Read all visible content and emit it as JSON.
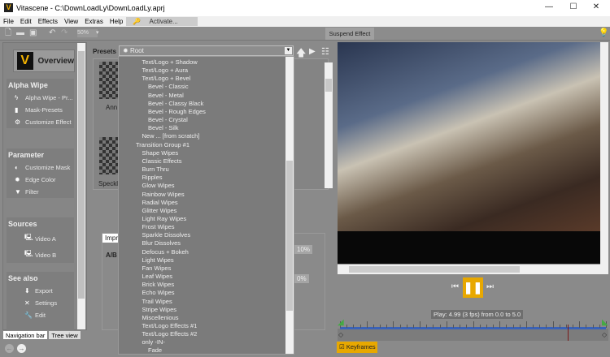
{
  "window": {
    "title": "Vitascene - C:\\DownLoadLy\\DownLoadLy.aprj",
    "minimize": "—",
    "maximize": "☐",
    "close": "✕"
  },
  "menu": [
    "File",
    "Edit",
    "Effects",
    "View",
    "Extras",
    "Help"
  ],
  "activate": "Activate...",
  "toolbar": {
    "zoom": "50%",
    "suspend": "Suspend Effect"
  },
  "overview": "Overview",
  "groups": [
    {
      "title": "Alpha Wipe",
      "items": [
        "Alpha Wipe - Pr...",
        "Mask-Presets",
        "Customize Effect"
      ]
    },
    {
      "title": "Parameter",
      "items": [
        "Customize Mask",
        "Edge Color",
        "Filter"
      ]
    },
    {
      "title": "Sources",
      "items": [
        "Video A",
        "Video B"
      ]
    },
    {
      "title": "See also",
      "items": [
        "Export",
        "Settings",
        "Edit"
      ]
    }
  ],
  "tabs": [
    "Navigation bar",
    "Tree view"
  ],
  "presets": {
    "label": "Presets",
    "root": "Root",
    "thumbs": [
      "Ann",
      "Speckl"
    ]
  },
  "dropdown": [
    {
      "t": "Text/Logo + Shadow",
      "l": 1
    },
    {
      "t": "Text/Logo + Aura",
      "l": 1
    },
    {
      "t": "Text/Logo + Bevel",
      "l": 1
    },
    {
      "t": "Bevel - Classic",
      "l": 2
    },
    {
      "t": "Bevel - Metal",
      "l": 2
    },
    {
      "t": "Bevel - Classy Black",
      "l": 2
    },
    {
      "t": "Bevel - Rough Edges",
      "l": 2
    },
    {
      "t": "Bevel - Crystal",
      "l": 2
    },
    {
      "t": "Bevel - Silk",
      "l": 2
    },
    {
      "t": "New ... [from scratch]",
      "l": 1
    },
    {
      "t": "Transition Group #1",
      "l": 0
    },
    {
      "t": "Shape Wipes",
      "l": 1
    },
    {
      "t": "Classic Effects",
      "l": 1
    },
    {
      "t": "Burn Thru",
      "l": 1
    },
    {
      "t": "Ripples",
      "l": 1
    },
    {
      "t": "Glow Wipes",
      "l": 1
    },
    {
      "t": "Rainbow Wipes",
      "l": 1
    },
    {
      "t": "Radial Wipes",
      "l": 1
    },
    {
      "t": "Glitter Wipes",
      "l": 1
    },
    {
      "t": "Light Ray Wipes",
      "l": 1
    },
    {
      "t": "Frost Wipes",
      "l": 1
    },
    {
      "t": "Sparkle Dissolves",
      "l": 1
    },
    {
      "t": "Blur Dissolves",
      "l": 1
    },
    {
      "t": "Defocus + Bokeh",
      "l": 1
    },
    {
      "t": "Light Wipes",
      "l": 1
    },
    {
      "t": "Fan Wipes",
      "l": 1
    },
    {
      "t": "Leaf Wipes",
      "l": 1
    },
    {
      "t": "Brick Wipes",
      "l": 1
    },
    {
      "t": "Echo Wipes",
      "l": 1
    },
    {
      "t": "Trail Wipes",
      "l": 1
    },
    {
      "t": "Stripe Wipes",
      "l": 1
    },
    {
      "t": "Miscellenious",
      "l": 1
    },
    {
      "t": "Text/Logo Effects #1",
      "l": 1
    },
    {
      "t": "Text/Logo Effects #2",
      "l": 1
    },
    {
      "t": "only -IN-",
      "l": 1
    },
    {
      "t": "Fade",
      "l": 2
    }
  ],
  "impr": {
    "tab": "Impre",
    "ab": "A/B",
    "v1": "10%",
    "v2": "0%"
  },
  "play": {
    "info": "Play: 4.99 (3 fps) from 0.0 to 5.0",
    "keyframes": "Keyframes"
  },
  "colors": {
    "accent": "#e8a800",
    "timeline": "#3a62b8"
  }
}
